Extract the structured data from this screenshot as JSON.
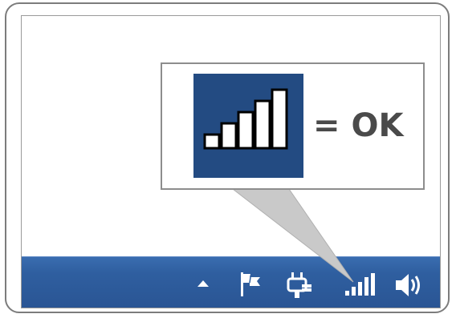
{
  "callout": {
    "text": "= OK",
    "signal_strength": "full",
    "tile_color": "#234b82",
    "text_color": "#4a4a4a"
  },
  "taskbar": {
    "color": "#2f5fa0",
    "tray_icons": [
      "show-hidden-icons-arrow-icon",
      "action-center-flag-icon",
      "power-plug-icon",
      "network-signal-icon",
      "speaker-volume-icon"
    ]
  }
}
